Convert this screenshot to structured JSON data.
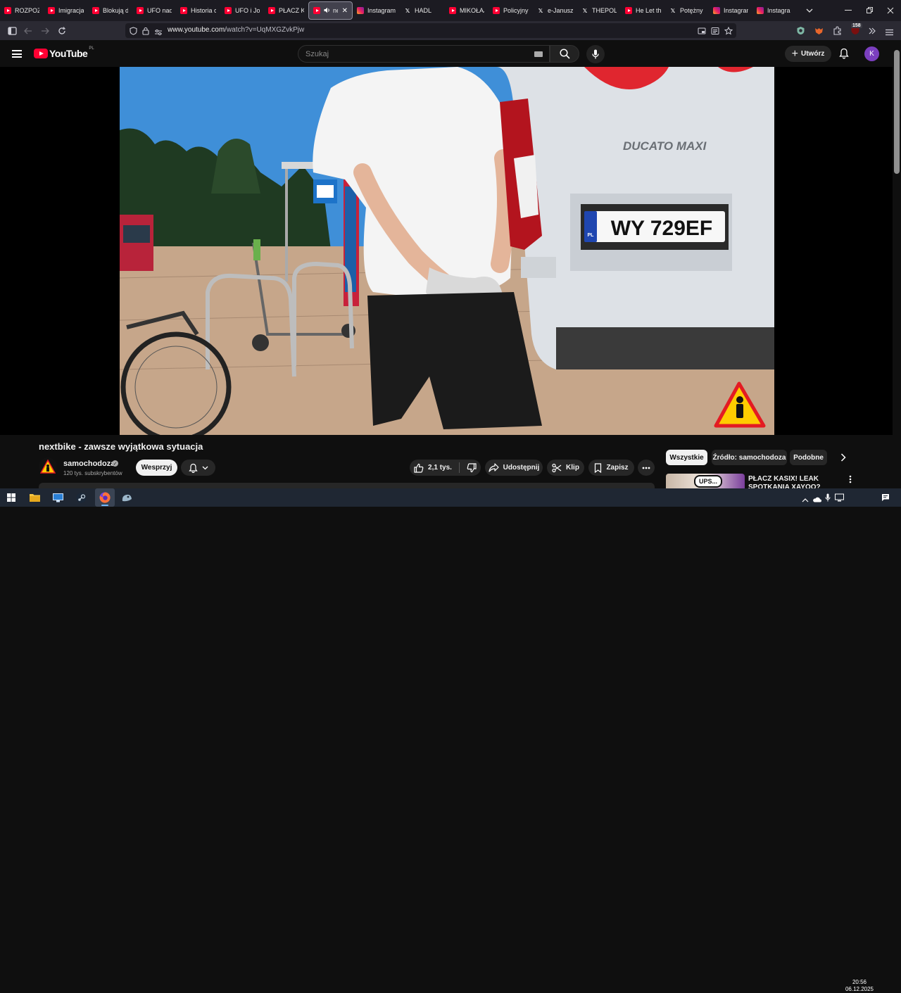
{
  "browser": {
    "tabs": [
      {
        "label": "ROZPOZN",
        "icon": "youtube-icon"
      },
      {
        "label": "Imigracja",
        "icon": "youtube-icon"
      },
      {
        "label": "Blokują d",
        "icon": "youtube-icon"
      },
      {
        "label": "UFO nad",
        "icon": "youtube-icon"
      },
      {
        "label": "Historia o",
        "icon": "youtube-icon"
      },
      {
        "label": "UFO i Joh",
        "icon": "youtube-icon"
      },
      {
        "label": "PŁACZ KA",
        "icon": "youtube-icon"
      },
      {
        "label": "nex",
        "icon": "youtube-icon",
        "active": true
      },
      {
        "label": "Instagram",
        "icon": "instagram-icon"
      },
      {
        "label": "HADL",
        "icon": "x-icon"
      },
      {
        "label": "MIKOŁAJ",
        "icon": "youtube-icon"
      },
      {
        "label": "Policyjny",
        "icon": "youtube-icon"
      },
      {
        "label": "e-Janusz",
        "icon": "x-icon"
      },
      {
        "label": "THEPOL",
        "icon": "x-icon"
      },
      {
        "label": "He Let th",
        "icon": "youtube-icon"
      },
      {
        "label": "Potężny S",
        "icon": "x-icon"
      },
      {
        "label": "Instagram",
        "icon": "instagram-icon"
      },
      {
        "label": "Instagram",
        "icon": "instagram-icon"
      }
    ],
    "url_host": "www.youtube.com",
    "url_path": "/watch?v=UqMXGZvkPjw",
    "extension_badge": "158"
  },
  "youtube": {
    "logo_text": "YouTube",
    "country_code": "PL",
    "search_placeholder": "Szukaj",
    "create_label": "Utwórz",
    "avatar_letter": "K"
  },
  "video": {
    "title": "nextbike - zawsze wyjątkowa sytuacja",
    "plate_text": "WY 729EF",
    "plate_country": "PL",
    "van_badge": "DUCATO MAXI"
  },
  "channel": {
    "name": "samochodoza",
    "subscribers": "120 tys. subskrybentów",
    "support_label": "Wesprzyj"
  },
  "actions": {
    "likes": "2,1 tys.",
    "share": "Udostępnij",
    "clip": "Klip",
    "save": "Zapisz"
  },
  "chips": [
    "Wszystkie",
    "Źródło: samochodoza",
    "Podobne"
  ],
  "recommendation": {
    "title": "PŁACZ KASIX! LEAK SPOTKANIA XAYOO?",
    "thumb_text": "UPS..."
  },
  "taskbar": {
    "time": "20:56",
    "date": "06.12.2025"
  },
  "colors": {
    "youtube_red": "#ff0033",
    "background": "#0f0f0f",
    "avatar": "#7b3fbf"
  }
}
